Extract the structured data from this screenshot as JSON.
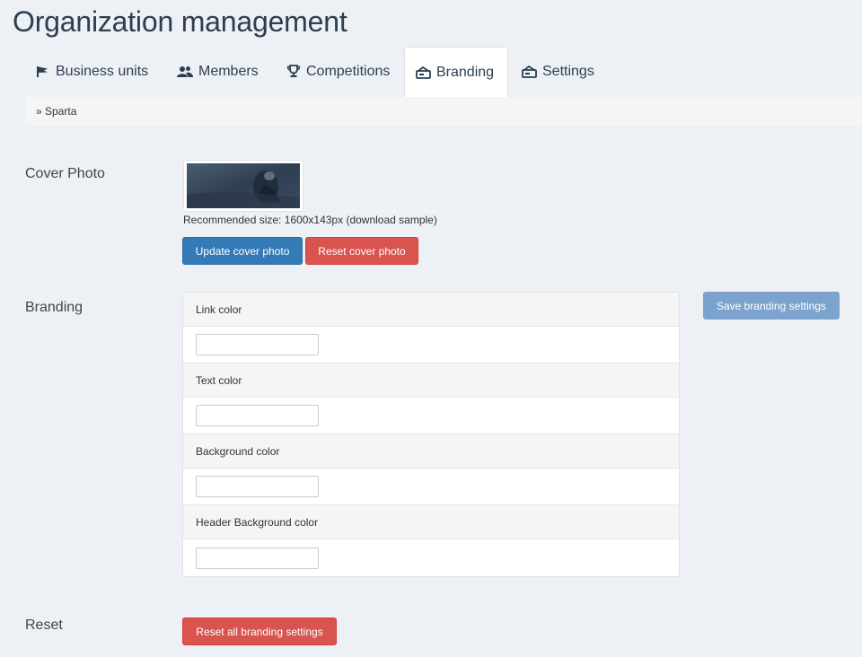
{
  "page": {
    "title": "Organization management"
  },
  "tabs": [
    {
      "label": "Business units",
      "icon": "flag-icon"
    },
    {
      "label": "Members",
      "icon": "users-icon"
    },
    {
      "label": "Competitions",
      "icon": "trophy-icon"
    },
    {
      "label": "Branding",
      "icon": "stamp-icon",
      "active": true
    },
    {
      "label": "Settings",
      "icon": "stamp-icon"
    }
  ],
  "breadcrumb": {
    "text": "» Sparta"
  },
  "cover": {
    "label": "Cover Photo",
    "hint": "Recommended size: 1600x143px (download sample)",
    "update_label": "Update cover photo",
    "reset_label": "Reset cover photo"
  },
  "branding": {
    "label": "Branding",
    "save_label": "Save branding settings",
    "fields": [
      {
        "label": "Link color",
        "value": ""
      },
      {
        "label": "Text color",
        "value": ""
      },
      {
        "label": "Background color",
        "value": ""
      },
      {
        "label": "Header Background color",
        "value": ""
      }
    ]
  },
  "reset": {
    "label": "Reset",
    "button_label": "Reset all branding settings"
  },
  "colors": {
    "primary": "#337ab7",
    "danger": "#d9534f",
    "disabled": "#7ba3cd",
    "background": "#edf1f5"
  }
}
